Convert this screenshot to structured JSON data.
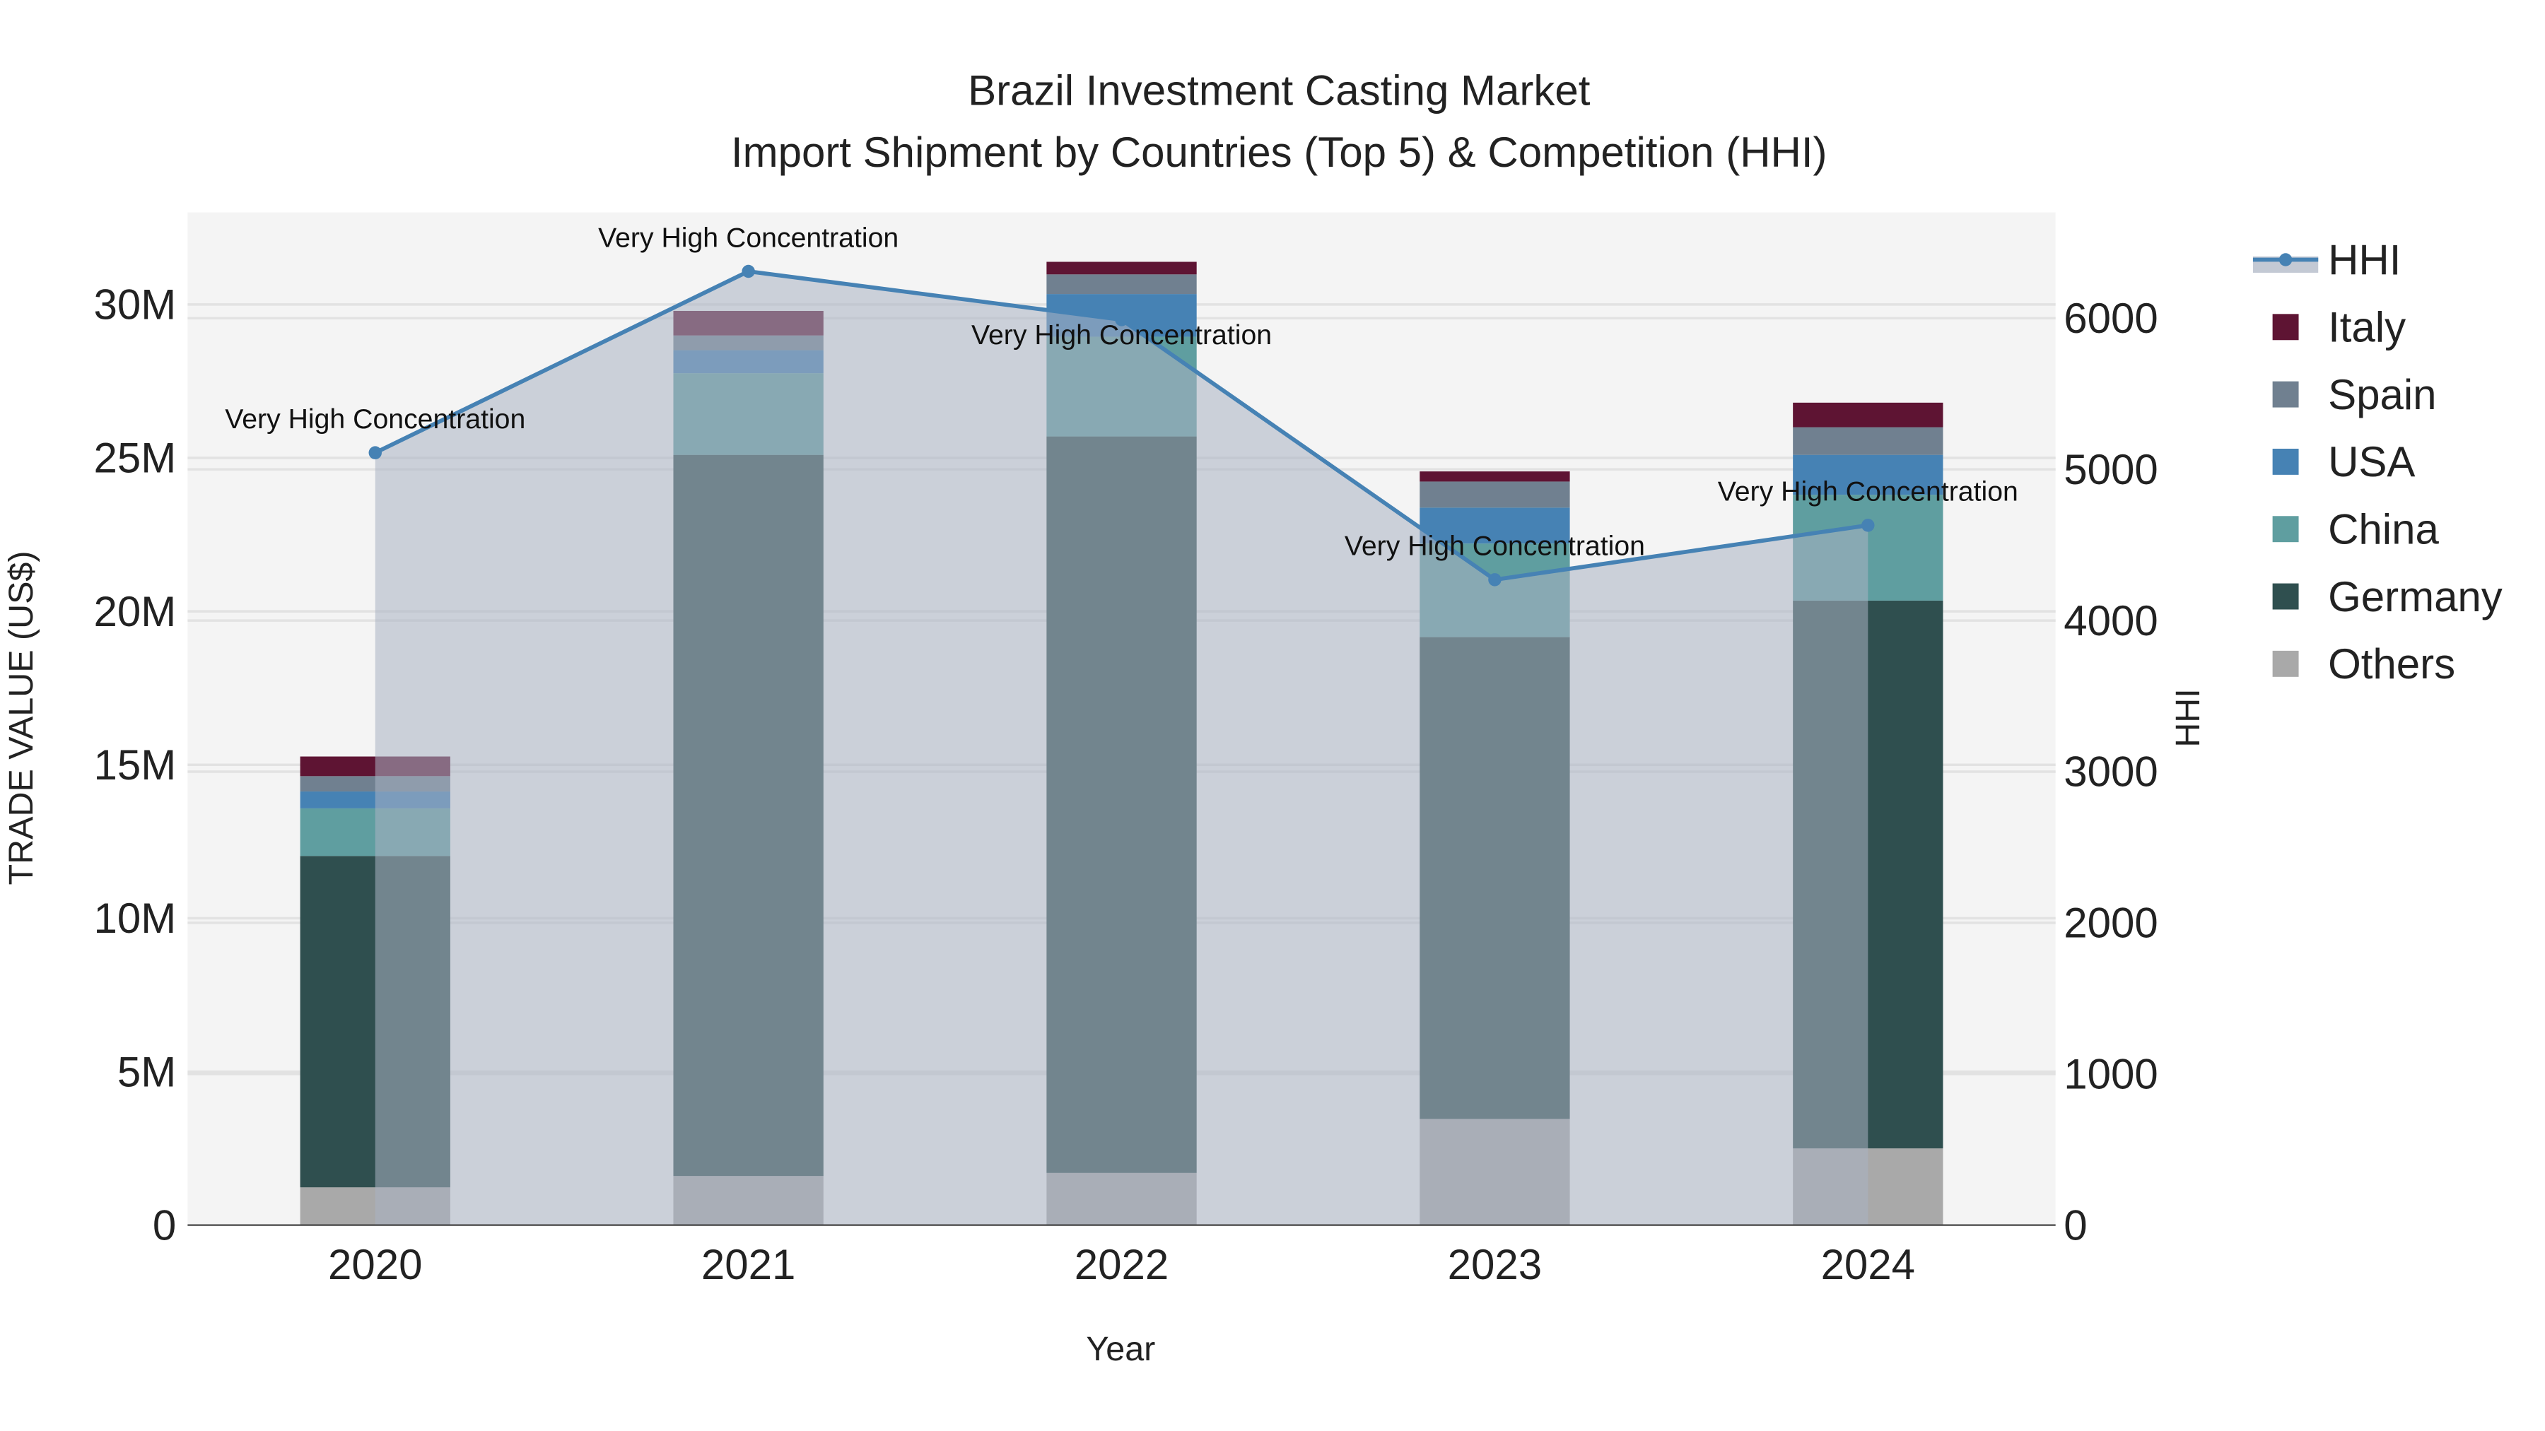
{
  "chart_data": {
    "type": "bar",
    "title": "Brazil Investment Casting Market",
    "subtitle": "Import Shipment by Countries (Top 5) & Competition (HHI)",
    "xlabel": "Year",
    "ylabel": "TRADE VALUE (US$)",
    "y2label": "HHI",
    "categories": [
      "2020",
      "2021",
      "2022",
      "2023",
      "2024"
    ],
    "ylim": [
      0,
      33000000
    ],
    "y2lim": [
      0,
      6700
    ],
    "yticks": [
      {
        "v": 0,
        "label": "0"
      },
      {
        "v": 5000000,
        "label": "5M"
      },
      {
        "v": 10000000,
        "label": "10M"
      },
      {
        "v": 15000000,
        "label": "15M"
      },
      {
        "v": 20000000,
        "label": "20M"
      },
      {
        "v": 25000000,
        "label": "25M"
      },
      {
        "v": 30000000,
        "label": "30M"
      }
    ],
    "y2ticks": [
      {
        "v": 0,
        "label": "0"
      },
      {
        "v": 1000,
        "label": "1000"
      },
      {
        "v": 2000,
        "label": "2000"
      },
      {
        "v": 3000,
        "label": "3000"
      },
      {
        "v": 4000,
        "label": "4000"
      },
      {
        "v": 5000,
        "label": "5000"
      },
      {
        "v": 6000,
        "label": "6000"
      }
    ],
    "grid": true,
    "legend_placement": "right",
    "series": [
      {
        "name": "Others",
        "color": "#a9a9a9",
        "values": [
          1230000,
          1600000,
          1700000,
          3460000,
          2500000
        ]
      },
      {
        "name": "Germany",
        "color": "#2f4f4f",
        "values": [
          10800000,
          23500000,
          24000000,
          15700000,
          17850000
        ]
      },
      {
        "name": "China",
        "color": "#5f9ea0",
        "values": [
          1550000,
          2660000,
          3250000,
          3050000,
          3450000
        ]
      },
      {
        "name": "USA",
        "color": "#4682b4",
        "values": [
          550000,
          750000,
          1390000,
          1170000,
          1300000
        ]
      },
      {
        "name": "Spain",
        "color": "#708090",
        "values": [
          500000,
          480000,
          640000,
          850000,
          900000
        ]
      },
      {
        "name": "Italy",
        "color": "#5e1433",
        "values": [
          640000,
          800000,
          410000,
          330000,
          800000
        ]
      }
    ],
    "hhi": {
      "name": "HHI",
      "color": "#4682b4",
      "values": [
        5110,
        6310,
        5990,
        4270,
        4630
      ]
    },
    "annotations": [
      "Very High Concentration",
      "Very High Concentration",
      "Very High Concentration",
      "Very High Concentration",
      "Very High Concentration"
    ],
    "legend_order": [
      "HHI",
      "Italy",
      "Spain",
      "USA",
      "China",
      "Germany",
      "Others"
    ]
  }
}
